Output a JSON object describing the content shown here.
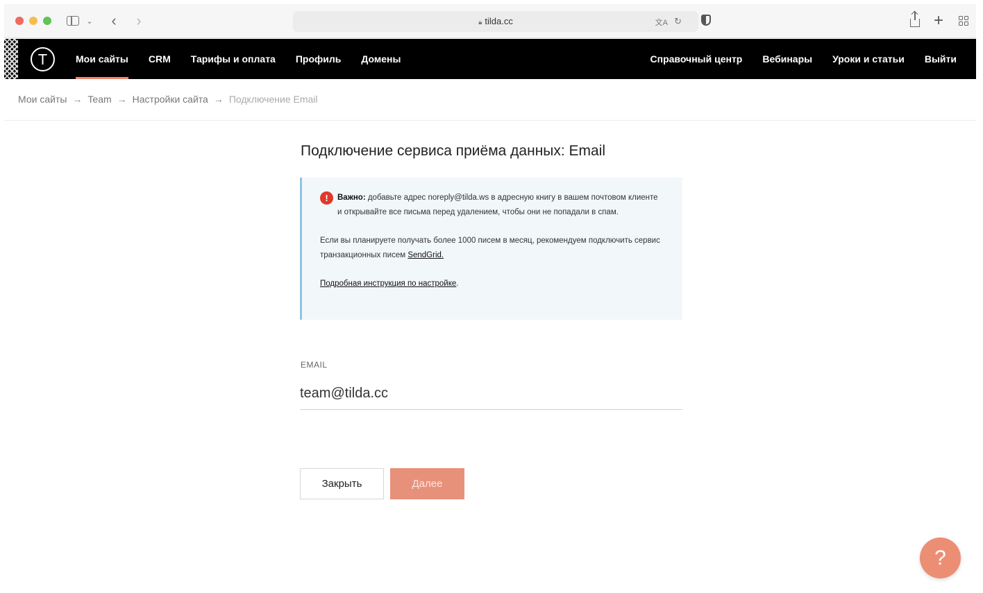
{
  "browser": {
    "url": "tilda.cc"
  },
  "nav": {
    "left": [
      {
        "label": "Мои сайты",
        "active": true
      },
      {
        "label": "CRM"
      },
      {
        "label": "Тарифы и оплата"
      },
      {
        "label": "Профиль"
      },
      {
        "label": "Домены"
      }
    ],
    "right": [
      {
        "label": "Справочный центр"
      },
      {
        "label": "Вебинары"
      },
      {
        "label": "Уроки и статьи"
      },
      {
        "label": "Выйти"
      }
    ]
  },
  "breadcrumb": {
    "items": [
      "Мои сайты",
      "Team",
      "Настройки сайта"
    ],
    "current": "Подключение Email",
    "separator": "→"
  },
  "page": {
    "title": "Подключение сервиса приёма данных: Email"
  },
  "info": {
    "important_label": "Важно:",
    "important_text": " добавьте адрес noreply@tilda.ws в адресную книгу в вашем почтовом клиенте и открывайте все письма перед удалением, чтобы они не попадали в спам.",
    "plan_text": "Если вы планируете получать более 1000 писем в месяц, рекомендуем подключить сервис транзакционных писем ",
    "sendgrid_link": "SendGrid.",
    "instruction_link": "Подробная инструкция по настройке",
    "instruction_suffix": "."
  },
  "form": {
    "email_label": "EMAIL",
    "email_value": "team@tilda.cc"
  },
  "buttons": {
    "close": "Закрыть",
    "next": "Далее"
  },
  "help": {
    "label": "?"
  },
  "colors": {
    "accent": "#e8917a",
    "nav_bg": "#000000",
    "info_bg": "#f2f7fa",
    "info_border": "#8fc4e0",
    "warning": "#e0392b"
  }
}
